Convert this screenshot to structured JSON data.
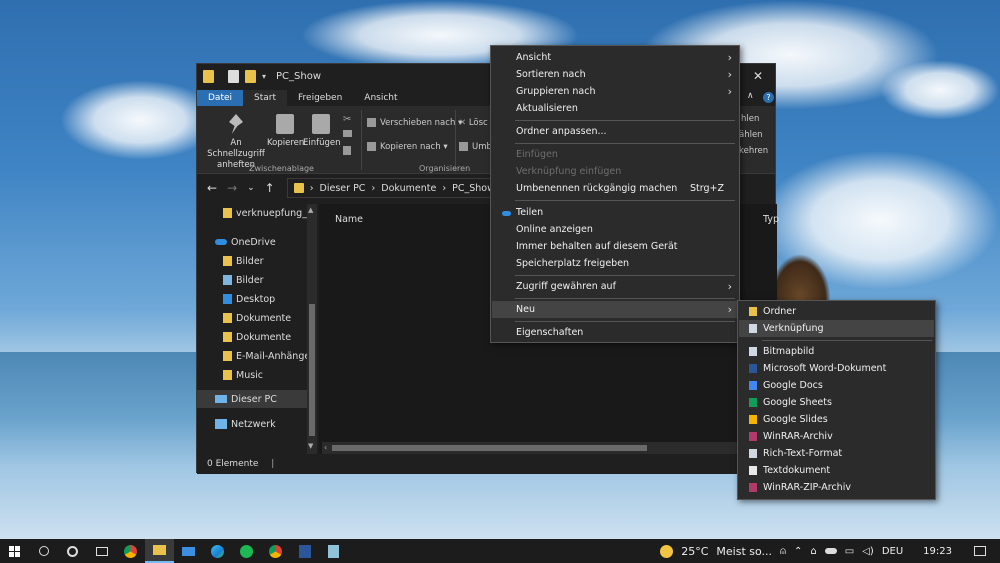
{
  "explorer": {
    "title": "PC_Show",
    "tabs": [
      "Datei",
      "Start",
      "Freigeben",
      "Ansicht"
    ],
    "ribbon": {
      "pin_label1": "An Schnellzugriff",
      "pin_label2": "anheften",
      "copy": "Kopieren",
      "paste": "Einfügen",
      "group_clipboard": "Zwischenablage",
      "move_to": "Verschieben nach",
      "copy_to": "Kopieren nach",
      "delete_partial": "Lösc",
      "rename_partial": "Umb",
      "group_organize": "Organisieren",
      "select_all_partial": "hlen",
      "select_none_partial": "ählen",
      "invert_partial": "kehren"
    },
    "breadcrumb": [
      "Dieser PC",
      "Dokumente",
      "PC_Show"
    ],
    "column_name": "Name",
    "column_type_partial": "Typ",
    "nav_items": [
      {
        "label": "verknuepfung_er",
        "icon": "file-icon"
      },
      {
        "label": "OneDrive",
        "icon": "onedrive-icon"
      },
      {
        "label": "Bilder",
        "icon": "folder-icon"
      },
      {
        "label": "Bilder",
        "icon": "pictures-icon"
      },
      {
        "label": "Desktop",
        "icon": "desktop-icon"
      },
      {
        "label": "Dokumente",
        "icon": "folder-icon"
      },
      {
        "label": "Dokumente",
        "icon": "folder-icon"
      },
      {
        "label": "E-Mail-Anhänge",
        "icon": "folder-icon"
      },
      {
        "label": "Music",
        "icon": "folder-icon"
      },
      {
        "label": "Dieser PC",
        "icon": "pc-icon"
      },
      {
        "label": "Netzwerk",
        "icon": "network-icon"
      }
    ],
    "status": "0 Elemente"
  },
  "context_menu": {
    "items": [
      {
        "label": "Ansicht",
        "submenu": true
      },
      {
        "label": "Sortieren nach",
        "submenu": true
      },
      {
        "label": "Gruppieren nach",
        "submenu": true
      },
      {
        "label": "Aktualisieren"
      },
      {
        "label": "Ordner anpassen..."
      },
      {
        "label": "Einfügen",
        "disabled": true
      },
      {
        "label": "Verknüpfung einfügen",
        "disabled": true
      },
      {
        "label": "Umbenennen rückgängig machen",
        "shortcut": "Strg+Z"
      },
      {
        "label": "Teilen"
      },
      {
        "label": "Online anzeigen"
      },
      {
        "label": "Immer behalten auf diesem Gerät"
      },
      {
        "label": "Speicherplatz freigeben"
      },
      {
        "label": "Zugriff gewähren auf",
        "submenu": true
      },
      {
        "label": "Neu",
        "submenu": true,
        "highlighted": true
      },
      {
        "label": "Eigenschaften"
      }
    ]
  },
  "new_submenu": {
    "items": [
      {
        "label": "Ordner",
        "icon": "folder-icon",
        "color": "#e8c24a"
      },
      {
        "label": "Verknüpfung",
        "icon": "shortcut-icon",
        "color": "#cfd8e3",
        "highlighted": true
      },
      {
        "label": "Bitmapbild",
        "icon": "bitmap-icon",
        "color": "#cfd8e3"
      },
      {
        "label": "Microsoft Word-Dokument",
        "icon": "word-icon",
        "color": "#2b579a"
      },
      {
        "label": "Google Docs",
        "icon": "google-docs-icon",
        "color": "#4285f4"
      },
      {
        "label": "Google Sheets",
        "icon": "google-sheets-icon",
        "color": "#0f9d58"
      },
      {
        "label": "Google Slides",
        "icon": "google-slides-icon",
        "color": "#f4b400"
      },
      {
        "label": "WinRAR-Archiv",
        "icon": "winrar-icon",
        "color": "#b03a6a"
      },
      {
        "label": "Rich-Text-Format",
        "icon": "rtf-icon",
        "color": "#cfd8e3"
      },
      {
        "label": "Textdokument",
        "icon": "text-icon",
        "color": "#e8e8e8"
      },
      {
        "label": "WinRAR-ZIP-Archiv",
        "icon": "winrar-zip-icon",
        "color": "#b03a6a"
      }
    ]
  },
  "taskbar": {
    "weather": "25°C",
    "weather_text": "Meist so...",
    "language": "DEU",
    "time": "19:23"
  }
}
